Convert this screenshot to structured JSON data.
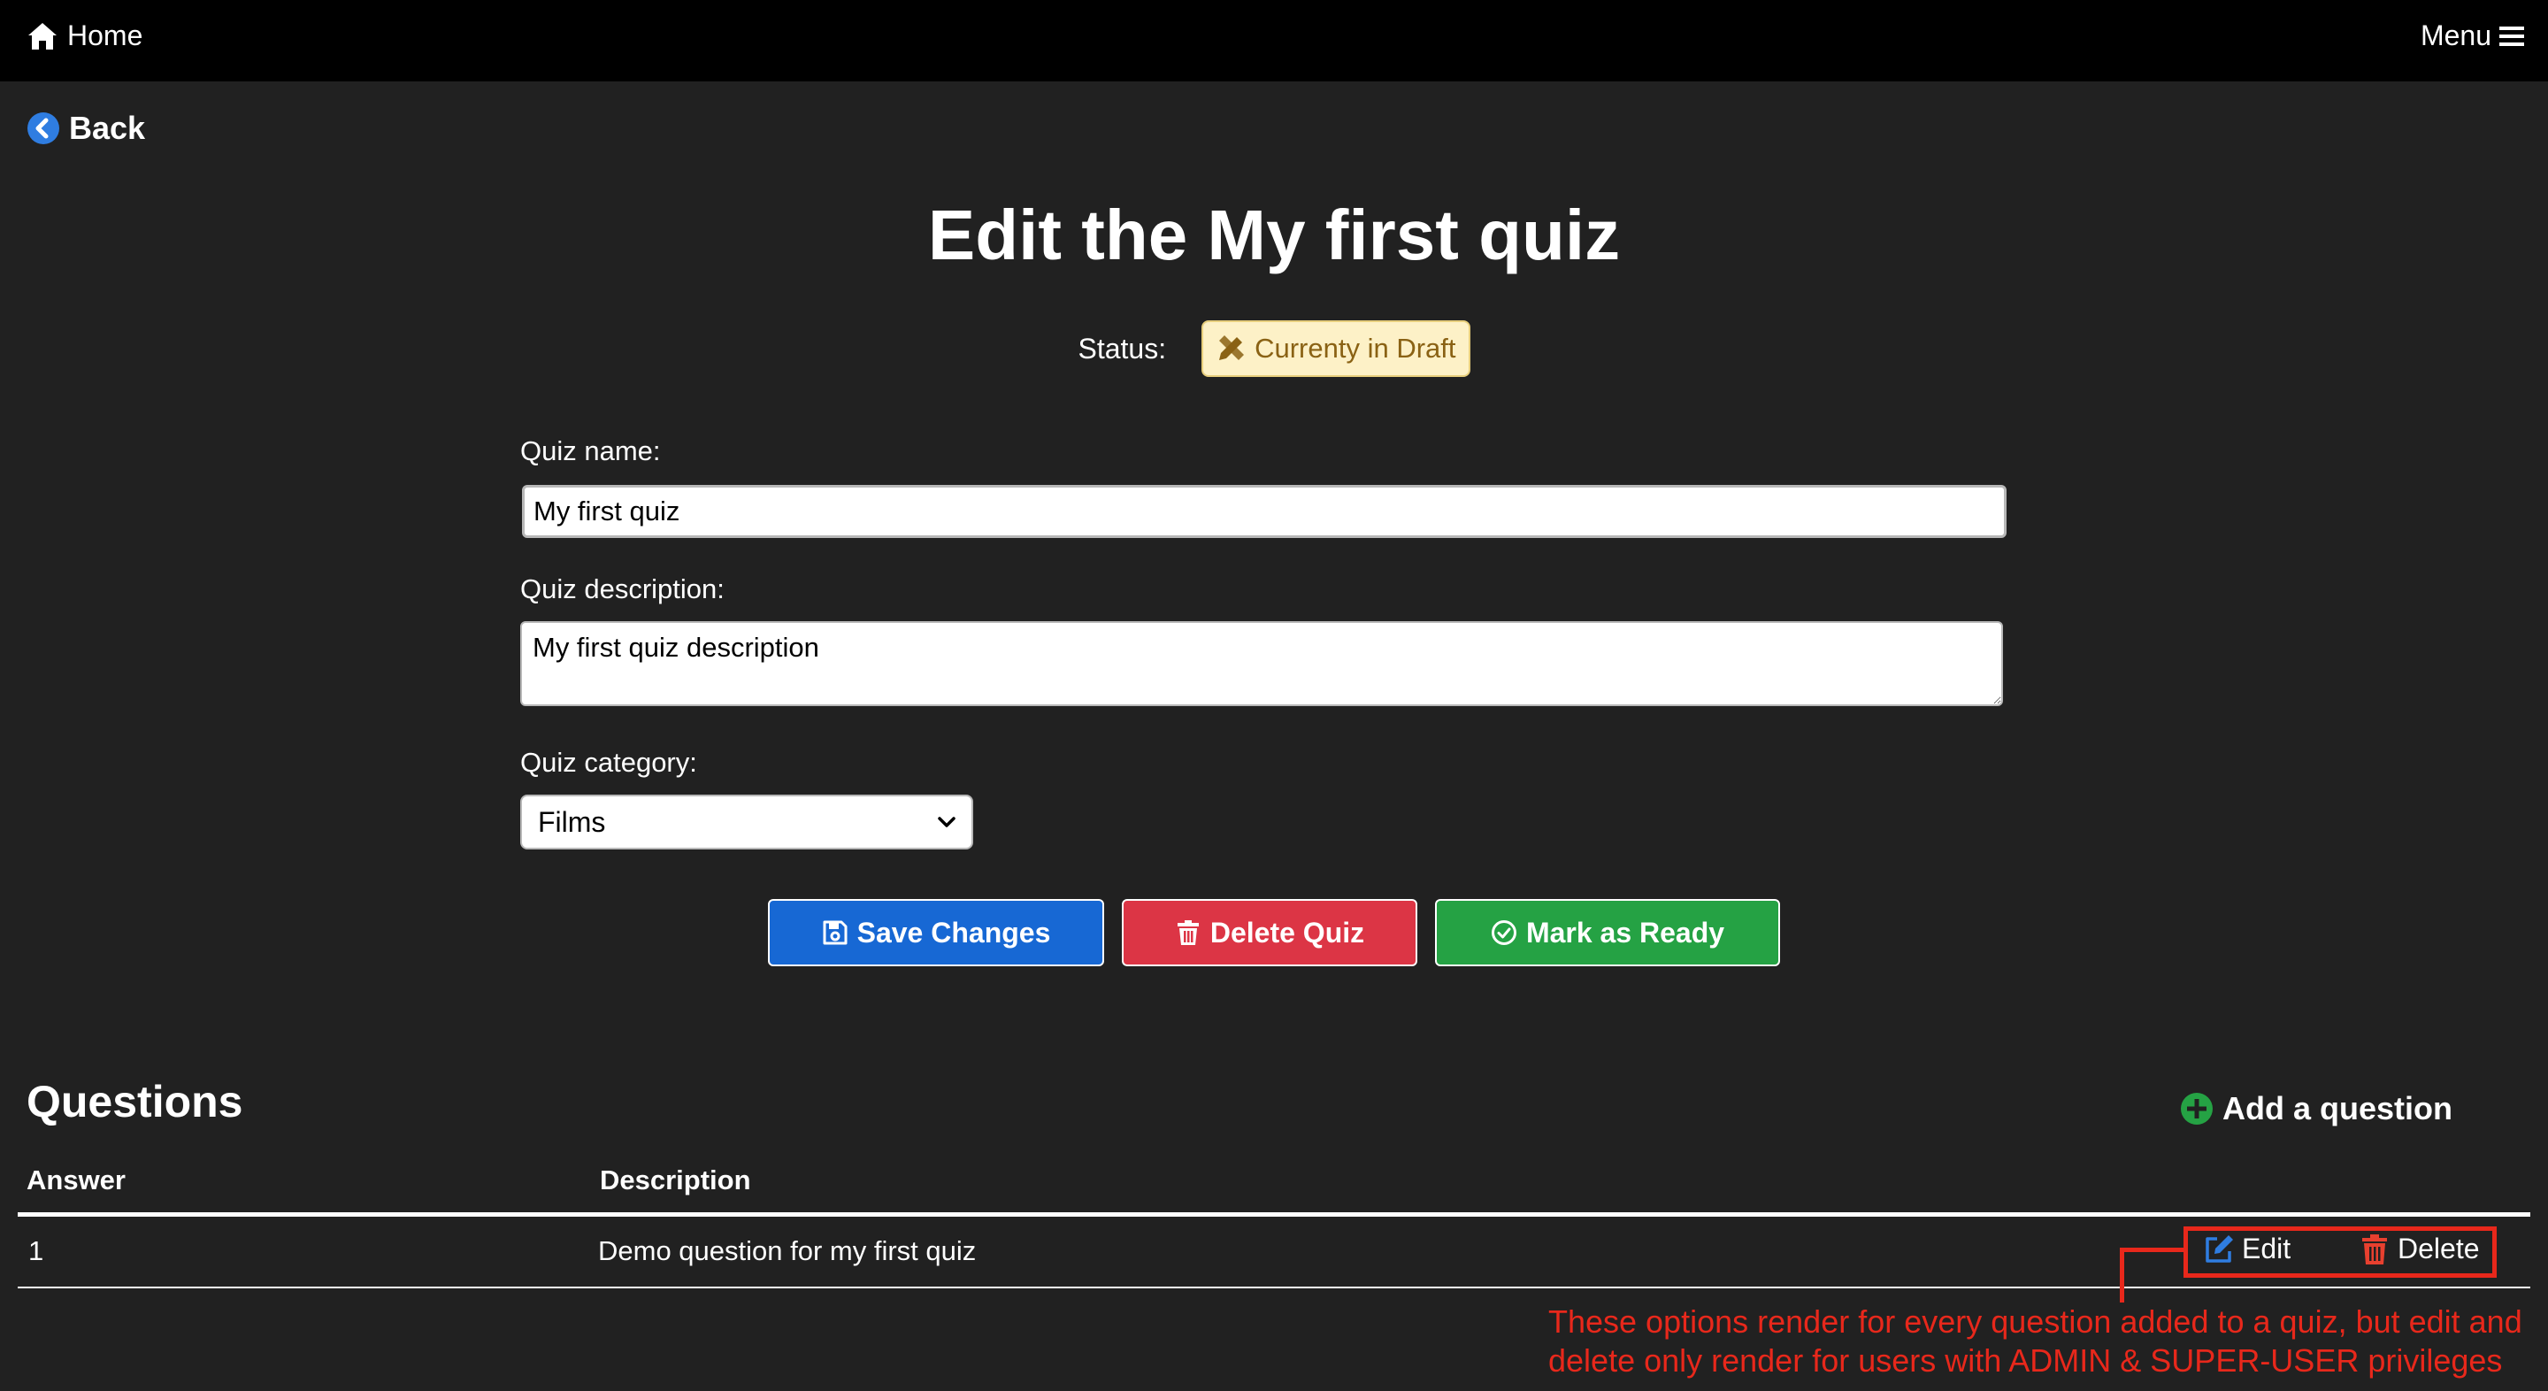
{
  "nav": {
    "home_label": "Home",
    "menu_label": "Menu"
  },
  "back_label": "Back",
  "page_title": "Edit the My first quiz",
  "status": {
    "label": "Status:",
    "badge_text": "Currenty in Draft",
    "badge_color": "#fdf1c7",
    "badge_text_color": "#8a6214"
  },
  "form": {
    "name_label": "Quiz name:",
    "name_value": "My first quiz",
    "description_label": "Quiz description:",
    "description_value": "My first quiz description",
    "category_label": "Quiz category:",
    "category_selected": "Films"
  },
  "buttons": {
    "save_label": "Save Changes",
    "delete_label": "Delete Quiz",
    "ready_label": "Mark as Ready",
    "save_color": "#1768d4",
    "delete_color": "#dc3545",
    "ready_color": "#25a244"
  },
  "questions": {
    "title": "Questions",
    "add_label": "Add a question",
    "columns": [
      "Answer",
      "Description"
    ],
    "rows": [
      {
        "answer": "1",
        "description": "Demo question for my first quiz",
        "edit_label": "Edit",
        "delete_label": "Delete"
      }
    ]
  },
  "annotation": {
    "text": "These options render for every question added to a quiz, but edit and delete only render for users with ADMIN & SUPER-USER privileges",
    "color": "#e8281b"
  },
  "icons": {
    "home": "home-icon",
    "menu": "bars-icon",
    "back": "chevron-left-circle-icon",
    "status": "pencil-ruler-icon",
    "save": "floppy-disk-icon",
    "delete": "trash-icon",
    "ready": "check-circle-icon",
    "add": "plus-circle-icon",
    "edit": "edit-square-icon",
    "select": "chevron-down-icon"
  }
}
